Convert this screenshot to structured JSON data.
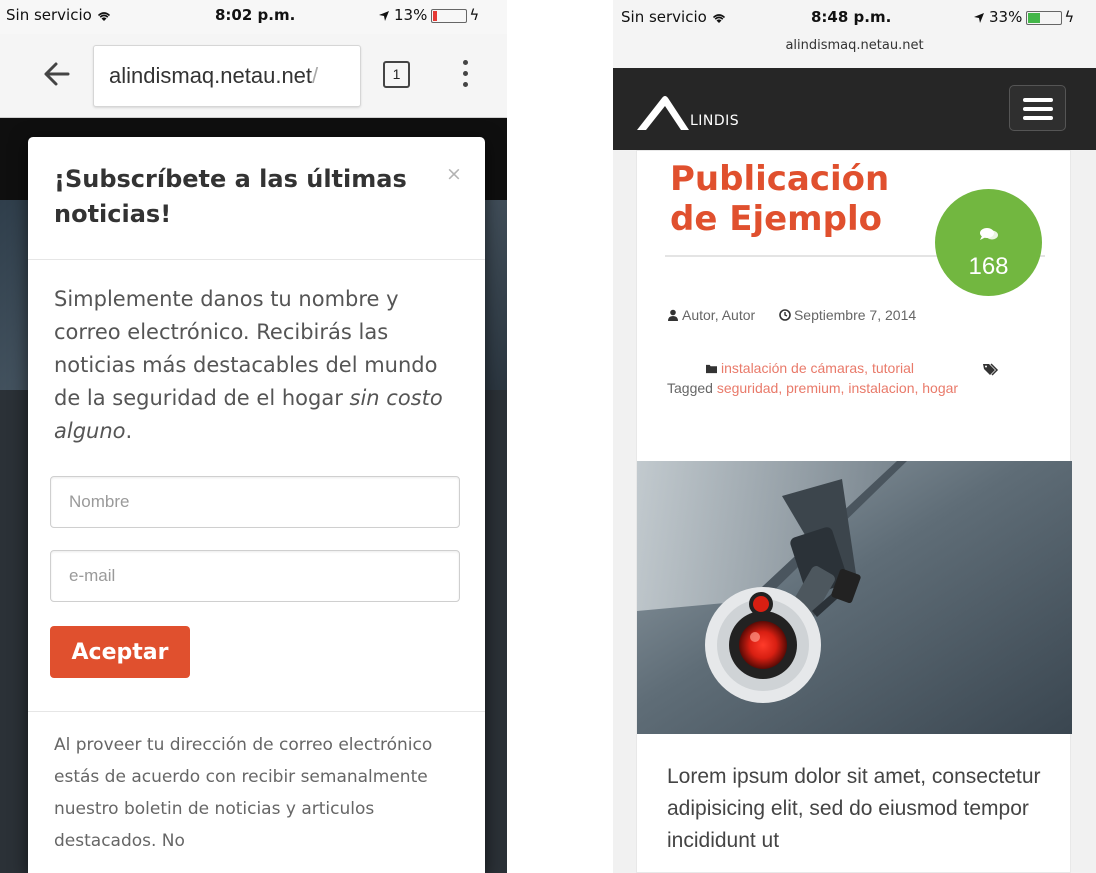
{
  "left_phone": {
    "status": {
      "carrier": "Sin servicio",
      "time": "8:02 p.m.",
      "battery": "13%"
    },
    "browser": {
      "url": "alindismaq.netau.net",
      "url_tail": "/",
      "tab_count": "1"
    },
    "modal": {
      "title": "¡Subscríbete a las últimas noticias!",
      "close": "×",
      "intro": "Simplemente danos tu nombre y correo electrónico. Recibirás las noticias más destacables del mundo de la seguridad de el hogar",
      "intro_emphasis": "sin costo alguno",
      "intro_end": ".",
      "name_placeholder": "Nombre",
      "email_placeholder": "e-mail",
      "accept_label": "Aceptar",
      "footer": "Al proveer tu dirección de correo electrónico estás de acuerdo con recibir semanalmente nuestro boletin de noticias y articulos destacados. No"
    }
  },
  "right_phone": {
    "status": {
      "carrier": "Sin servicio",
      "time": "8:48 p.m.",
      "battery": "33%",
      "url": "alindismaq.netau.net"
    },
    "nav": {
      "logo_text": "LINDIS"
    },
    "post": {
      "title": "Publicación de Ejemplo",
      "comments": "168",
      "author": "Autor, Autor",
      "date": "Septiembre 7, 2014",
      "categories": "instalación de cámaras, tutorial",
      "tagged_label": "Tagged",
      "tags": "seguridad, premium, instalacion, hogar",
      "excerpt": "Lorem ipsum dolor sit amet, consectetur adipisicing elit, sed do eiusmod tempor incididunt ut"
    }
  },
  "colors": {
    "accent": "#e0502e",
    "badge": "#72b740",
    "nav_bg": "#262626",
    "link": "#e97a6a"
  }
}
